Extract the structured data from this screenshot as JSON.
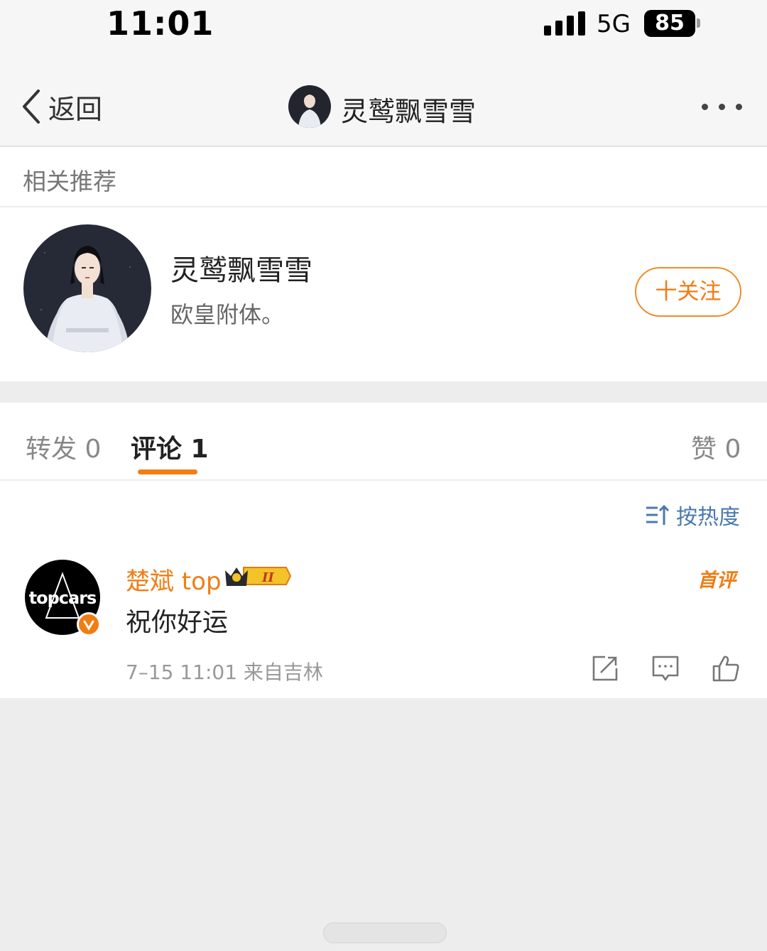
{
  "status_bar": {
    "time": "11:01",
    "network": "5G",
    "battery": "85"
  },
  "nav": {
    "back_label": "返回",
    "title": "灵鹫飘雪雪"
  },
  "recommend": {
    "header": "相关推荐",
    "name": "灵鹫飘雪雪",
    "description": "欧皇附体。",
    "follow_label": "十关注"
  },
  "tabs": {
    "reposts": "转发 0",
    "comments": "评论 1",
    "likes": "赞 0"
  },
  "sort": {
    "label": "按热度"
  },
  "comment": {
    "author": "楚斌 top",
    "avatar_text": "topcars",
    "badge_level": "II",
    "first_tag": "首评",
    "text": "祝你好运",
    "meta": "7–15 11:01  来自吉林"
  },
  "colors": {
    "accent": "#f07d14",
    "link": "#4a79ae"
  },
  "icons": [
    "back-chevron-icon",
    "more-icon",
    "sort-icon",
    "crown-icon",
    "verified-icon",
    "share-icon",
    "comment-icon",
    "like-icon"
  ]
}
